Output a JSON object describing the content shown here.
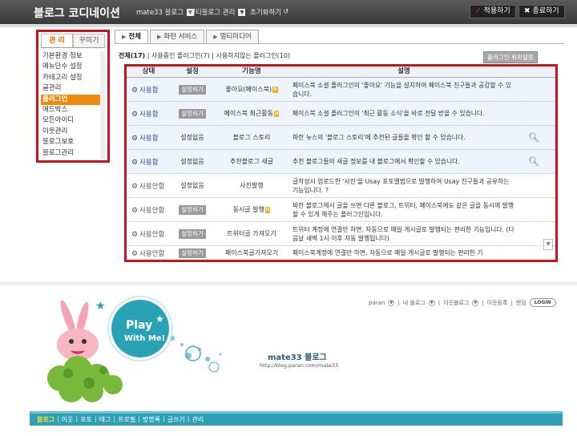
{
  "topbar": {
    "title": "블로그 코디네이션",
    "blog_menu": "mate33 블로그",
    "multi_menu": "멀티블로그 관리",
    "init": "초기화하기",
    "apply": "적용하기",
    "close": "종료하기"
  },
  "left_panel": {
    "tabs": [
      "관 리",
      "꾸미기"
    ],
    "items": [
      "기본환경 정보",
      "메뉴단수 설정",
      "카테고리 설정",
      "글관리",
      "플러그인",
      "애드박스",
      "모든아이디",
      "이웃관리",
      "블로그보호",
      "블로그관리"
    ]
  },
  "main_tabs": [
    "전체",
    "파란 서비스",
    "멀티미디어"
  ],
  "summary": {
    "all": "전체(17)",
    "text": " | 사용중인 플러그인(7) | 사용하지않는 플러그인(10)",
    "location_button": "플러그인 위치설정"
  },
  "table": {
    "headers": [
      "상태",
      "설정",
      "기능명",
      "설명"
    ],
    "rows": [
      {
        "status": "사용함",
        "setting": "설정하기",
        "name": "좋아요(페이스북)",
        "new": "N",
        "desc": "페이스북 소셜 플러그인의 '좋아요' 기능을 설치하여 페이스북 친구들과 공감할 수 있습니다.",
        "zoom": false,
        "used": true
      },
      {
        "status": "사용함",
        "setting": "설정하기",
        "name": "페이스북 최근활동",
        "new": "N",
        "desc": "페이스북 소셜 플러그인의 '최근 활동 소식'을 바로 전달 받을 수 있습니다.",
        "zoom": false,
        "used": true
      },
      {
        "status": "사용함",
        "setting": "설정없음",
        "name": "블로그 스토리",
        "new": "",
        "desc": "파란 뉴스의 '블로그 스토리'에 추천된 글들을 확인 할 수 있습니다.",
        "zoom": true,
        "used": true
      },
      {
        "status": "사용함",
        "setting": "설정없음",
        "name": "추천블로그 새글",
        "new": "",
        "desc": "추천 블로그들의 새글 정보를 내 블로그에서 확인할 수 있습니다.",
        "zoom": true,
        "used": true
      },
      {
        "status": "사용안함",
        "setting": "설정없음",
        "name": "사진발행",
        "new": "",
        "desc": "글작성시 업로드한 '사진'을 Usay 포토앨범으로 발행하여 Usay 친구들과 공유하는 기능입니다. ?",
        "zoom": false,
        "used": false
      },
      {
        "status": "사용안함",
        "setting": "설정하기",
        "name": "동시글 발행",
        "new": "N",
        "desc": "파란 블로그에서 글을 쓰면 다른 블로그, 트위터, 페이스북에도 같은 글을 동시에 발행할 수 있게 해주는 플러그인입니다.",
        "zoom": false,
        "used": false
      },
      {
        "status": "사용안함",
        "setting": "설정하기",
        "name": "트위터글 가져오기",
        "new": "",
        "desc": "트위터 계정에 연결만 하면, 자동으로 매일 게시글로 발행되는 편리한 기능입니다. (다음날 새벽 1시 이후 자동 발행됩니다)",
        "zoom": false,
        "used": false
      },
      {
        "status": "사용안함",
        "setting": "설정하기",
        "name": "페이스북글가져오기",
        "new": "",
        "desc": "페이스북계정에 연결만 하면, 자동으로 매일 게시글로 발행되는 편리한 기",
        "zoom": false,
        "used": false
      }
    ]
  },
  "blog": {
    "topnav": [
      "paran",
      "내 블로그",
      "이웃블로그",
      "이웃등록",
      "랜덤",
      "LOGIN"
    ],
    "play_text1": "Play",
    "play_text2": "With Me!",
    "title": "mate33 블로그",
    "url": "http://blog.paran.com/mate33",
    "nav": [
      "블로그",
      "이웃",
      "포토",
      "태그",
      "프로필",
      "방명록",
      "글쓰기",
      "관리"
    ]
  },
  "colors": {
    "highlight_border": "#c8141c",
    "active_item": "#f08a0c",
    "nav_bar": "#2e9fb4"
  }
}
